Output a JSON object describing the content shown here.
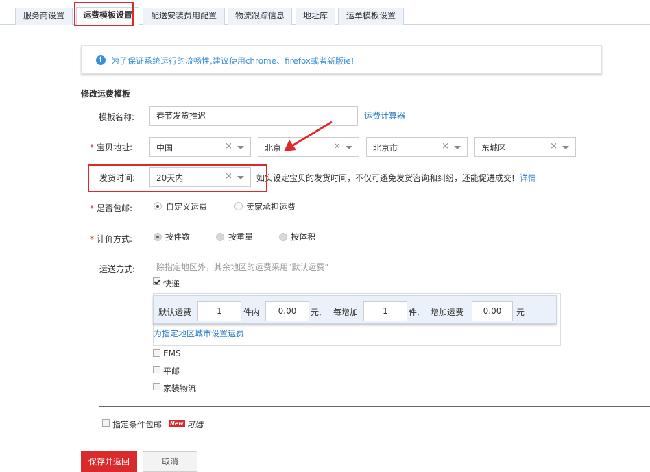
{
  "tabs": [
    {
      "label": "服务商设置",
      "active": false
    },
    {
      "label": "运费模板设置",
      "active": true
    },
    {
      "label": "配送安装费用配置",
      "active": false
    },
    {
      "label": "物流跟踪信息",
      "active": false
    },
    {
      "label": "地址库",
      "active": false
    },
    {
      "label": "运单模板设置",
      "active": false
    }
  ],
  "banner": {
    "text": "为了保证系统运行的流畅性,建议使用chrome、firefox或者新版ie!"
  },
  "form": {
    "section_title": "修改运费模板",
    "template_name": {
      "label": "模板名称:",
      "value": "春节发货推迟",
      "link": "运费计算器"
    },
    "address": {
      "label": "宝贝地址:",
      "required_mark": "*",
      "country": "中国",
      "province": "北京",
      "city": "北京市",
      "district": "东城区"
    },
    "ship_time": {
      "label": "发货时间:",
      "value": "20天内",
      "hint": "如实设定宝贝的发货时间，不仅可避免发货咨询和纠纷，还能促进成交!",
      "link": "详情"
    },
    "free_shipping": {
      "label": "是否包邮:",
      "required_mark": "*",
      "options": [
        "自定义运费",
        "卖家承担运费"
      ],
      "selected": "自定义运费"
    },
    "pricing": {
      "label": "计价方式:",
      "required_mark": "*",
      "options": [
        "按件数",
        "按重量",
        "按体积"
      ],
      "selected": "按件数"
    },
    "shipping_method": {
      "label": "运送方式:",
      "note": "除指定地区外，其余地区的运费采用\"默认运费\"",
      "express": {
        "label": "快递",
        "checked": true,
        "default_fee_label": "默认运费",
        "first_count": "1",
        "first_unit": "件内",
        "first_fee": "0.00",
        "yuan": "元,",
        "each_add_label": "每增加",
        "add_count": "1",
        "add_unit": "件,",
        "add_fee_label": "增加运费",
        "add_fee": "0.00",
        "yuan2": "元",
        "region_link": "为指定地区城市设置运费"
      },
      "ems": {
        "label": "EMS",
        "checked": false
      },
      "surface_mail": {
        "label": "平邮",
        "checked": false
      },
      "furniture": {
        "label": "家装物流",
        "checked": false
      }
    },
    "conditional_free": {
      "label": "指定条件包邮",
      "badge": "New",
      "optional": "可选",
      "checked": false
    }
  },
  "buttons": {
    "save": "保存并返回",
    "cancel": "取消"
  },
  "colors": {
    "accent_red": "#d92b2b",
    "link_blue": "#2b7dc9",
    "annotation_red": "#e0282b"
  }
}
